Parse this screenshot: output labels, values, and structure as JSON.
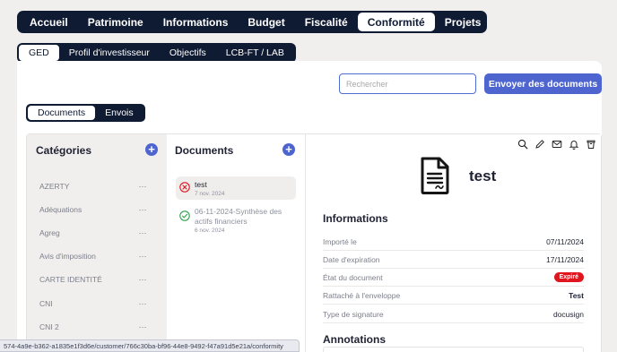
{
  "main_nav": {
    "tabs": [
      {
        "label": "Accueil"
      },
      {
        "label": "Patrimoine"
      },
      {
        "label": "Informations"
      },
      {
        "label": "Budget"
      },
      {
        "label": "Fiscalité"
      },
      {
        "label": "Conformité",
        "active": true
      },
      {
        "label": "Projets"
      }
    ]
  },
  "sub_nav": {
    "tabs": [
      {
        "label": "GED",
        "active": true
      },
      {
        "label": "Profil d'investisseur"
      },
      {
        "label": "Objectifs"
      },
      {
        "label": "LCB-FT / LAB"
      }
    ]
  },
  "search": {
    "placeholder": "Rechercher",
    "value": ""
  },
  "send_button": {
    "label": "Envoyer des documents"
  },
  "view_toggle": {
    "tabs": [
      {
        "label": "Documents",
        "active": true
      },
      {
        "label": "Envois"
      }
    ]
  },
  "categories": {
    "title": "Catégories",
    "items": [
      {
        "label": "AZERTY"
      },
      {
        "label": "Adéquations"
      },
      {
        "label": "Agreg"
      },
      {
        "label": "Avis d'imposition"
      },
      {
        "label": "CARTE IDENTITÉ"
      },
      {
        "label": "CNI"
      },
      {
        "label": "CNI 2"
      }
    ],
    "more_icon": "⋯"
  },
  "documents": {
    "title": "Documents",
    "items": [
      {
        "name": "test",
        "date": "7 nov. 2024",
        "status": "error-icon",
        "selected": true
      },
      {
        "name": "06-11-2024-Synthèse des actifs financiers",
        "date": "6 nov. 2024",
        "status": "check-icon",
        "selected": false
      }
    ]
  },
  "detail": {
    "title": "test",
    "toolbar_icons": [
      "search-icon",
      "edit-icon",
      "mail-icon",
      "bell-icon",
      "trash-icon"
    ],
    "informations_title": "Informations",
    "rows": [
      {
        "label": "Importé le",
        "value": "07/11/2024"
      },
      {
        "label": "Date d'expiration",
        "value": "17/11/2024"
      },
      {
        "label": "État du document",
        "badge": "Expiré"
      },
      {
        "label": "Rattaché à l'enveloppe",
        "value": "Test",
        "bold": true
      },
      {
        "label": "Type de signature",
        "value": "docusign"
      }
    ],
    "annotations_title": "Annotations"
  },
  "colors": {
    "navy": "#0f1b33",
    "accent": "#4e65d0",
    "danger": "#e0151e",
    "success": "#2ea14a"
  },
  "status_url": "574-4a9e-b362-a1835e1f3d6e/customer/766c30ba-bf96-44e8-9492-f47a91d5e21a/conformity"
}
